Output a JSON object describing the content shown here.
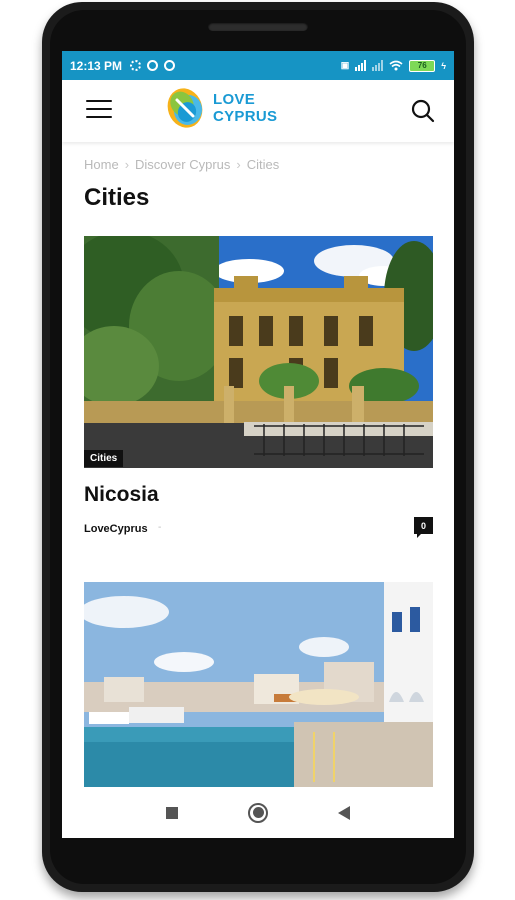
{
  "status_bar": {
    "time": "12:13 PM",
    "battery": "76"
  },
  "header": {
    "logo_line1": "LOVE",
    "logo_line2": "CYPRUS",
    "brand_color": "#1a9ad4",
    "status_color": "#1694c4"
  },
  "breadcrumb": {
    "items": [
      "Home",
      "Discover Cyprus",
      "Cities"
    ],
    "separator": "›"
  },
  "page_title": "Cities",
  "posts": [
    {
      "category": "Cities",
      "title": "Nicosia",
      "author": "LoveCyprus",
      "comments": "0"
    }
  ],
  "icons": {
    "menu": "hamburger-icon",
    "search": "search-icon",
    "nav_recent": "square-icon",
    "nav_home": "circle-icon",
    "nav_back": "triangle-back-icon"
  }
}
